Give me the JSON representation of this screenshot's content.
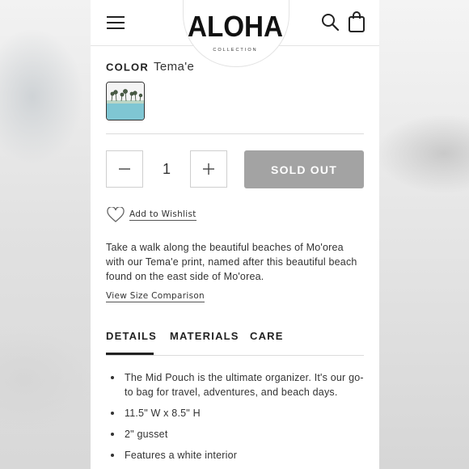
{
  "header": {
    "brand_main": "ALOHA",
    "brand_sub": "COLLECTION"
  },
  "product": {
    "color_label": "COLOR",
    "color_value": "Tema'e",
    "quantity": "1",
    "sold_out_label": "SOLD OUT",
    "wishlist_label": "Add to Wishlist",
    "description": "Take a walk along the beautiful beaches of Mo'orea with our Tema'e print, named after this beautiful beach found on the east side of Mo'orea.",
    "size_link": "View Size Comparison"
  },
  "tabs": [
    {
      "label": "DETAILS",
      "active": true
    },
    {
      "label": "MATERIALS",
      "active": false
    },
    {
      "label": "CARE",
      "active": false
    }
  ],
  "details": [
    "The Mid Pouch is the ultimate organizer. It's our go-to bag for travel, adventures, and beach days.",
    "11.5\" W x 8.5\" H",
    "2\" gusset",
    "Features a white interior"
  ],
  "colors": {
    "sold_out_bg": "#a3a3a3",
    "text": "#222222",
    "swatch_water": "#7fc6d3"
  },
  "icons": [
    "hamburger-menu-icon",
    "search-icon",
    "shopping-bag-icon",
    "minus-icon",
    "plus-icon",
    "heart-icon"
  ]
}
